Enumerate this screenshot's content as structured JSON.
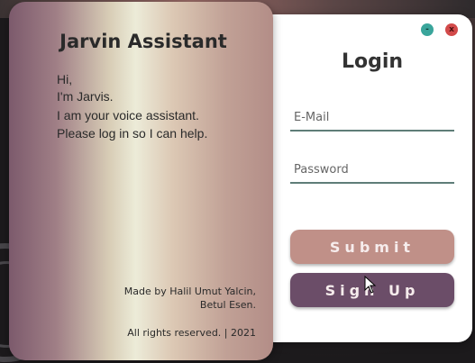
{
  "window": {
    "minimize_label": "-",
    "close_label": "x"
  },
  "info_panel": {
    "title": "Jarvin Assistant",
    "greeting": [
      "Hi,",
      "I'm Jarvis.",
      "I am your voice assistant.",
      "Please log in so I can help."
    ],
    "credit_line1": "Made by Halil Umut Yalcin,",
    "credit_line2": "Betul Esen.",
    "copyright": "All rights reserved. | 2021"
  },
  "login": {
    "title": "Login",
    "email_placeholder": "E-Mail",
    "email_value": "",
    "password_placeholder": "Password",
    "password_value": "",
    "submit_label": "Submit",
    "signup_label": "Sign Up"
  },
  "colors": {
    "submit_bg": "#c09088",
    "signup_bg": "#6b4d68",
    "minimize_btn": "#3aa59b",
    "close_btn": "#d24a4a",
    "field_underline": "#5f7d78"
  },
  "icons": {
    "cursor": "mouse-pointer-icon"
  }
}
